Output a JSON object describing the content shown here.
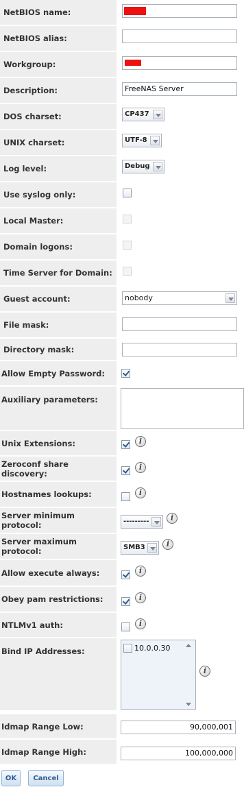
{
  "fields": {
    "netbios_name": {
      "label": "NetBIOS name:"
    },
    "netbios_alias": {
      "label": "NetBIOS alias:",
      "value": ""
    },
    "workgroup": {
      "label": "Workgroup:"
    },
    "description": {
      "label": "Description:",
      "value": "FreeNAS Server"
    },
    "dos_charset": {
      "label": "DOS charset:",
      "value": "CP437"
    },
    "unix_charset": {
      "label": "UNIX charset:",
      "value": "UTF-8"
    },
    "log_level": {
      "label": "Log level:",
      "value": "Debug"
    },
    "use_syslog": {
      "label": "Use syslog only:",
      "checked": false
    },
    "local_master": {
      "label": "Local Master:",
      "checked": false,
      "disabled": true
    },
    "domain_logons": {
      "label": "Domain logons:",
      "checked": false,
      "disabled": true
    },
    "time_server": {
      "label": "Time Server for Domain:",
      "checked": false,
      "disabled": true
    },
    "guest_account": {
      "label": "Guest account:",
      "value": "nobody"
    },
    "file_mask": {
      "label": "File mask:",
      "value": ""
    },
    "directory_mask": {
      "label": "Directory mask:",
      "value": ""
    },
    "allow_empty_password": {
      "label": "Allow Empty Password:",
      "checked": true
    },
    "auxiliary_parameters": {
      "label": "Auxiliary parameters:",
      "value": ""
    },
    "unix_extensions": {
      "label": "Unix Extensions:",
      "checked": true
    },
    "zeroconf": {
      "label": "Zeroconf share discovery:",
      "checked": true
    },
    "hostnames_lookups": {
      "label": "Hostnames lookups:",
      "checked": false
    },
    "server_min_protocol": {
      "label": "Server minimum protocol:",
      "value": "---------"
    },
    "server_max_protocol": {
      "label": "Server maximum protocol:",
      "value": "SMB3"
    },
    "allow_execute_always": {
      "label": "Allow execute always:",
      "checked": true
    },
    "obey_pam": {
      "label": "Obey pam restrictions:",
      "checked": true
    },
    "ntlmv1_auth": {
      "label": "NTLMv1 auth:",
      "checked": false
    },
    "bind_ip": {
      "label": "Bind IP Addresses:",
      "options": [
        "10.0.0.30"
      ]
    },
    "idmap_low": {
      "label": "Idmap Range Low:",
      "value": "90,000,001"
    },
    "idmap_high": {
      "label": "Idmap Range High:",
      "value": "100,000,000"
    }
  },
  "buttons": {
    "ok": "OK",
    "cancel": "Cancel"
  },
  "icons": {
    "info": "info-icon",
    "glyph": "i"
  }
}
